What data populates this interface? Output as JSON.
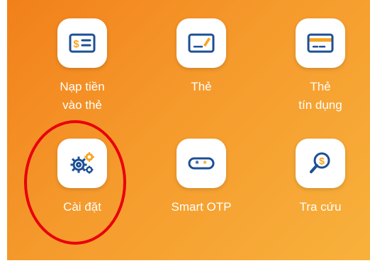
{
  "colors": {
    "background_start": "#f2801a",
    "background_end": "#f8b13c",
    "icon_blue": "#1c4f96",
    "icon_orange": "#f5a623",
    "highlight_circle": "#e8000b"
  },
  "menu": {
    "items": [
      {
        "label": "Nạp tiền\nvào thẻ",
        "icon": "money-card-icon"
      },
      {
        "label": "Thẻ",
        "icon": "card-edit-icon"
      },
      {
        "label": "Thẻ\ntín dụng",
        "icon": "credit-card-icon"
      },
      {
        "label": "Cài đặt",
        "icon": "settings-gears-icon"
      },
      {
        "label": "Smart OTP",
        "icon": "password-otp-icon"
      },
      {
        "label": "Tra cứu",
        "icon": "search-money-icon"
      }
    ]
  }
}
